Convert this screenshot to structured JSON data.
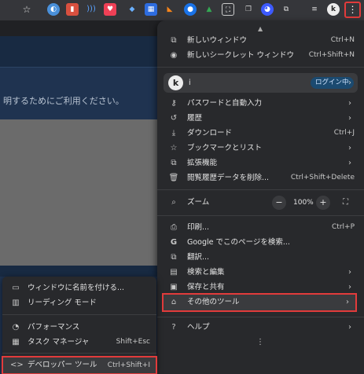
{
  "page": {
    "text": "明するためにご利用ください。"
  },
  "toolbar": {
    "profile_letter": "k",
    "menu_glyph": "⋮",
    "icons": [
      "star-icon",
      "extension-icon",
      "extension-icon",
      "extension-icon",
      "pocket-icon",
      "extension-icon",
      "extension-icon",
      "metamask-icon",
      "extension-icon",
      "drive-icon",
      "extension-icon",
      "extension-icon",
      "extension-icon",
      "puzzle-icon",
      "media-icon",
      "avatar",
      "kebab-menu-icon"
    ]
  },
  "menu": {
    "new_window": {
      "label": "新しいウィンドウ",
      "shortcut": "Ctrl+N"
    },
    "new_incognito": {
      "label": "新しいシークレット ウィンドウ",
      "shortcut": "Ctrl+Shift+N"
    },
    "profile": {
      "letter": "k",
      "name": "i",
      "badge": "ログイン中"
    },
    "passwords": {
      "label": "パスワードと自動入力"
    },
    "history": {
      "label": "履歴"
    },
    "downloads": {
      "label": "ダウンロード",
      "shortcut": "Ctrl+J"
    },
    "bookmarks": {
      "label": "ブックマークとリスト"
    },
    "extensions": {
      "label": "拡張機能"
    },
    "clear_data": {
      "label": "閲覧履歴データを削除...",
      "shortcut": "Ctrl+Shift+Delete"
    },
    "zoom": {
      "label": "ズーム",
      "minus": "−",
      "value": "100%",
      "plus": "+"
    },
    "print": {
      "label": "印刷...",
      "shortcut": "Ctrl+P"
    },
    "google_search": {
      "label": "Google でこのページを検索..."
    },
    "translate": {
      "label": "翻訳..."
    },
    "search_edit": {
      "label": "検索と編集"
    },
    "save_share": {
      "label": "保存と共有"
    },
    "more_tools": {
      "label": "その他のツール"
    },
    "help": {
      "label": "ヘルプ"
    }
  },
  "submenu": {
    "name_window": {
      "label": "ウィンドウに名前を付ける..."
    },
    "reading_mode": {
      "label": "リーディング モード"
    },
    "performance": {
      "label": "パフォーマンス"
    },
    "task_manager": {
      "label": "タスク マネージャ",
      "shortcut": "Shift+Esc"
    },
    "devtools": {
      "label": "デベロッパー ツール",
      "shortcut": "Ctrl+Shift+I"
    }
  },
  "colors": {
    "highlight": "#e23b3b",
    "menu_bg": "#28292c",
    "page_bg": "#1f3350"
  }
}
